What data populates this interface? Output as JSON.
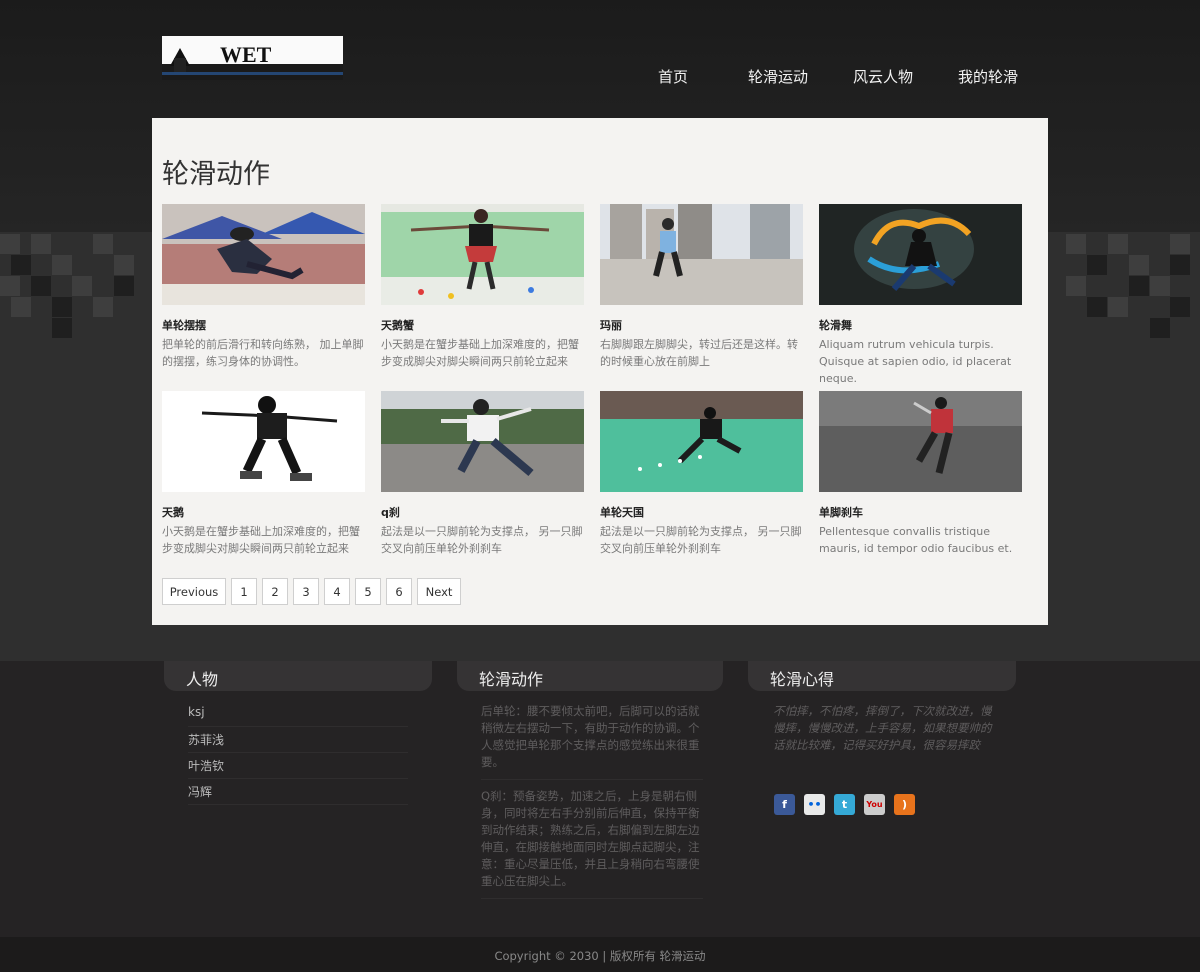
{
  "site": {
    "logo_alt": "WET"
  },
  "nav": {
    "items": [
      "首页",
      "轮滑运动",
      "风云人物",
      "我的轮滑"
    ]
  },
  "gallery": {
    "title": "轮滑动作",
    "cards": [
      {
        "name": "单轮摆摆",
        "desc": "把单轮的前后滑行和转向练熟， 加上单脚的摆摆，练习身体的协调性。"
      },
      {
        "name": "天鹅蟹",
        "desc": "小天鹅是在蟹步基础上加深难度的，把蟹步变成脚尖对脚尖瞬间两只前轮立起来"
      },
      {
        "name": "玛丽",
        "desc": "右脚脚跟左脚脚尖，转过后还是这样。转的时候重心放在前脚上"
      },
      {
        "name": "轮滑舞",
        "desc": "Aliquam rutrum vehicula turpis. Quisque at sapien odio, id placerat neque."
      },
      {
        "name": "天鹅",
        "desc": "小天鹅是在蟹步基础上加深难度的，把蟹步变成脚尖对脚尖瞬间两只前轮立起来"
      },
      {
        "name": "q刹",
        "desc": "起法是以一只脚前轮为支撑点， 另一只脚交叉向前压单轮外刹刹车"
      },
      {
        "name": "单轮天国",
        "desc": "起法是以一只脚前轮为支撑点， 另一只脚交叉向前压单轮外刹刹车"
      },
      {
        "name": "单脚刹车",
        "desc": "Pellentesque convallis tristique mauris, id tempor odio faucibus et."
      }
    ]
  },
  "pagination": {
    "prev": "Previous",
    "pages": [
      "1",
      "2",
      "3",
      "4",
      "5",
      "6"
    ],
    "next": "Next"
  },
  "footer": {
    "people": {
      "title": "人物",
      "items": [
        "ksj",
        "苏菲浅",
        "叶浩钦",
        "冯辉"
      ]
    },
    "tips": {
      "title": "轮滑动作",
      "paragraphs": [
        "后单轮：腰不要倾太前吧，后脚可以的话就稍微左右摆动一下，有助于动作的协调。个人感觉把单轮那个支撑点的感觉练出来很重要。",
        "Q刹：预备姿势，加速之后，上身是朝右侧身，同时将左右手分别前后伸直，保持平衡到动作结束；熟练之后，右脚偏到左脚左边伸直，在脚接触地面同时左脚点起脚尖，注意：重心尽量压低，并且上身稍向右弯腰使重心压在脚尖上。"
      ]
    },
    "experience": {
      "title": "轮滑心得",
      "quote": "不怕摔，不怕疼，摔倒了，下次就改进，慢慢摔，慢慢改进，上手容易，如果想要帅的话就比较难，记得买好护具，很容易摔跤"
    },
    "social": [
      "facebook-icon",
      "flickr-icon",
      "twitter-icon",
      "youtube-icon",
      "rss-icon"
    ],
    "copyright": "Copyright © 2030 | 版权所有 轮滑运动"
  },
  "colors": {
    "panel": "#f4f3f1",
    "footer": "#252324",
    "accent_text": "#333333"
  }
}
